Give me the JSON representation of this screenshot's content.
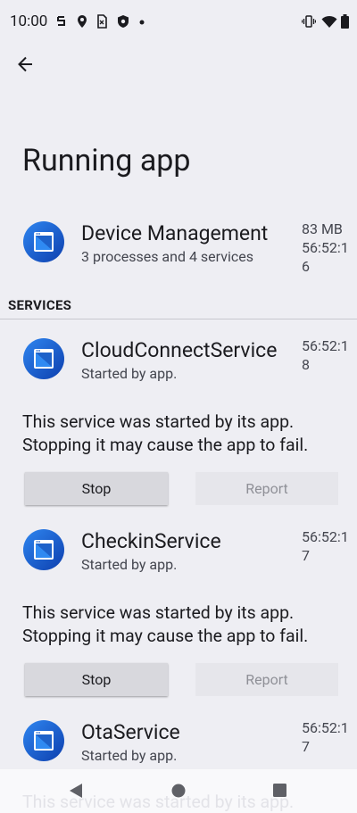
{
  "status": {
    "time": "10:00"
  },
  "page": {
    "title": "Running app"
  },
  "app": {
    "name": "Device Management",
    "subtitle": "3 processes and 4 services",
    "memory": "83 MB",
    "time": "56:52:16"
  },
  "section": {
    "header": "SERVICES"
  },
  "services": [
    {
      "name": "CloudConnectService",
      "subtitle": "Started by app.",
      "time": "56:52:18",
      "description": "This service was started by its app. Stopping it may cause the app to fail.",
      "stop_label": "Stop",
      "report_label": "Report"
    },
    {
      "name": "CheckinService",
      "subtitle": "Started by app.",
      "time": "56:52:17",
      "description": "This service was started by its app. Stopping it may cause the app to fail.",
      "stop_label": "Stop",
      "report_label": "Report"
    },
    {
      "name": "OtaService",
      "subtitle": "Started by app.",
      "time": "56:52:17",
      "description": "This service was started by its app."
    }
  ],
  "icons": {
    "back": "arrow-back-icon",
    "app": "device-management-app-icon",
    "nav": [
      "back-triangle-icon",
      "home-circle-icon",
      "recents-square-icon"
    ]
  },
  "colors": {
    "background": "#eeeef3",
    "app_icon_blue": "#1e6fd9",
    "stop_button": "#d8d8dd",
    "report_button": "#e6e6eb"
  }
}
